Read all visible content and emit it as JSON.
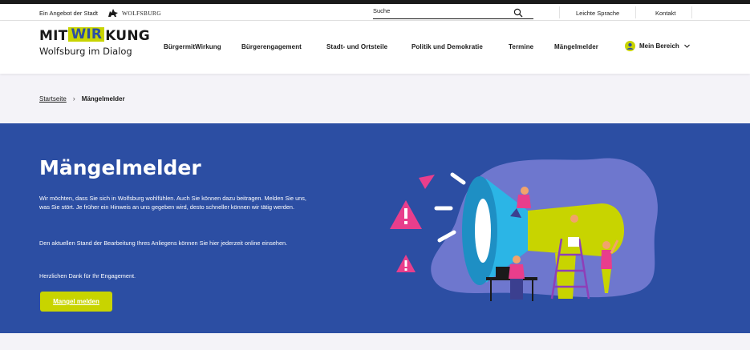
{
  "metabar": {
    "provider_text": "Ein Angebot der Stadt",
    "city_logo_text": "WOLFSBURG",
    "search_label": "Suche",
    "links": [
      "Leichte Sprache",
      "Kontakt"
    ]
  },
  "header": {
    "brand_mit": "MIT",
    "brand_wir": "WIR",
    "brand_kung": "KUNG",
    "brand_sub": "Wolfsburg im Dialog",
    "nav": [
      "BürgermitWirkung",
      "Bürgerengagement",
      "Stadt- und Ortsteile",
      "Politik und Demokratie",
      "Termine",
      "Mängelmelder"
    ],
    "account_label": "Mein Bereich"
  },
  "breadcrumb": {
    "home": "Startseite",
    "current": "Mängelmelder"
  },
  "hero": {
    "title": "Mängelmelder",
    "paragraphs": [
      "Wir möchten, dass Sie sich in Wolfsburg wohlfühlen. Auch Sie können dazu beitragen. Melden Sie uns, was Sie stört. Je früher ein Hinweis an uns gegeben wird, desto schneller können wir tätig werden.",
      "Den aktuellen Stand der Bearbeitung Ihres Anliegens können Sie hier jederzeit online einsehen.",
      "Herzlichen Dank für Ihr Engagement."
    ],
    "button_label": "Mangel melden"
  },
  "colors": {
    "accent_green": "#c8d400",
    "hero_blue": "#2c4ea3",
    "illustration_pink": "#e83e8c",
    "illustration_cyan": "#2bb5e6"
  }
}
